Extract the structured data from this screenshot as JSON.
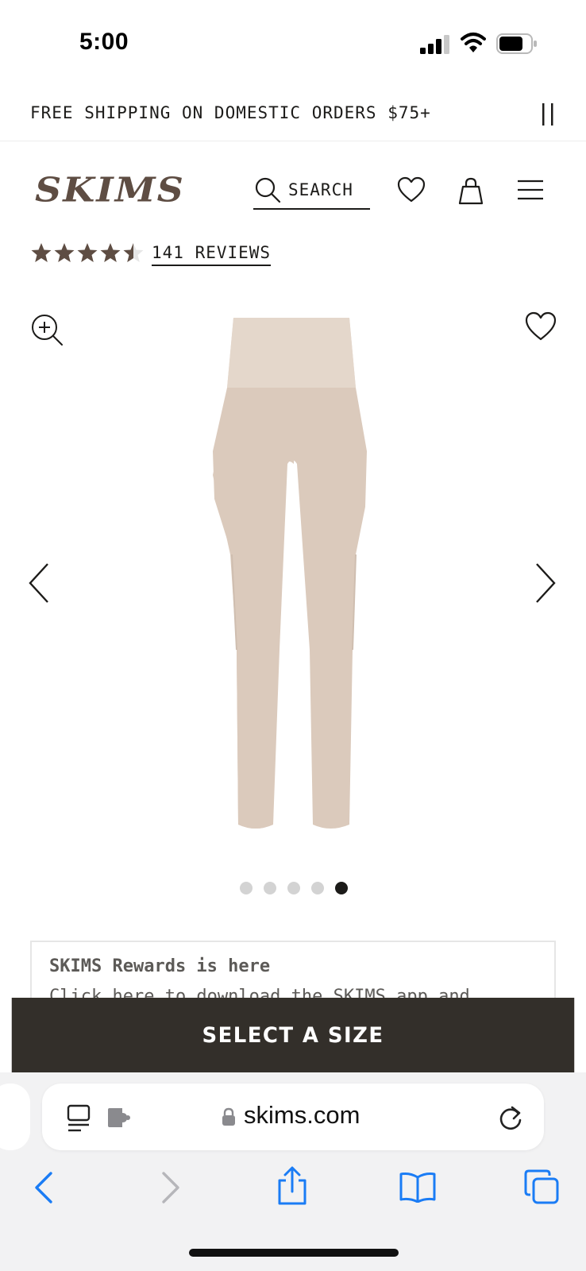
{
  "status_bar": {
    "time": "5:00"
  },
  "promo": {
    "text": "FREE SHIPPING ON DOMESTIC ORDERS $75+"
  },
  "header": {
    "logo": "SKIMS",
    "search_label": "SEARCH"
  },
  "rating": {
    "value": 4.5,
    "max": 5,
    "reviews_label": "141 REVIEWS"
  },
  "gallery": {
    "image_count": 5,
    "active_index": 5,
    "product_color": "#dccbbd"
  },
  "rewards": {
    "title": "SKIMS Rewards is here",
    "subtitle": "Click here to download the SKIMS app and"
  },
  "cta": {
    "label": "SELECT A SIZE"
  },
  "browser": {
    "url": "skims.com"
  },
  "colors": {
    "brand": "#5e4d43",
    "cta_bg": "#332f2a",
    "ios_blue": "#1a7cf5"
  },
  "icons": [
    "pause-icon",
    "search-icon",
    "heart-icon",
    "bag-icon",
    "menu-icon",
    "zoom-in-icon",
    "chevron-left-icon",
    "chevron-right-icon",
    "lock-icon",
    "reload-icon",
    "share-icon",
    "bookmarks-icon",
    "tabs-icon"
  ]
}
